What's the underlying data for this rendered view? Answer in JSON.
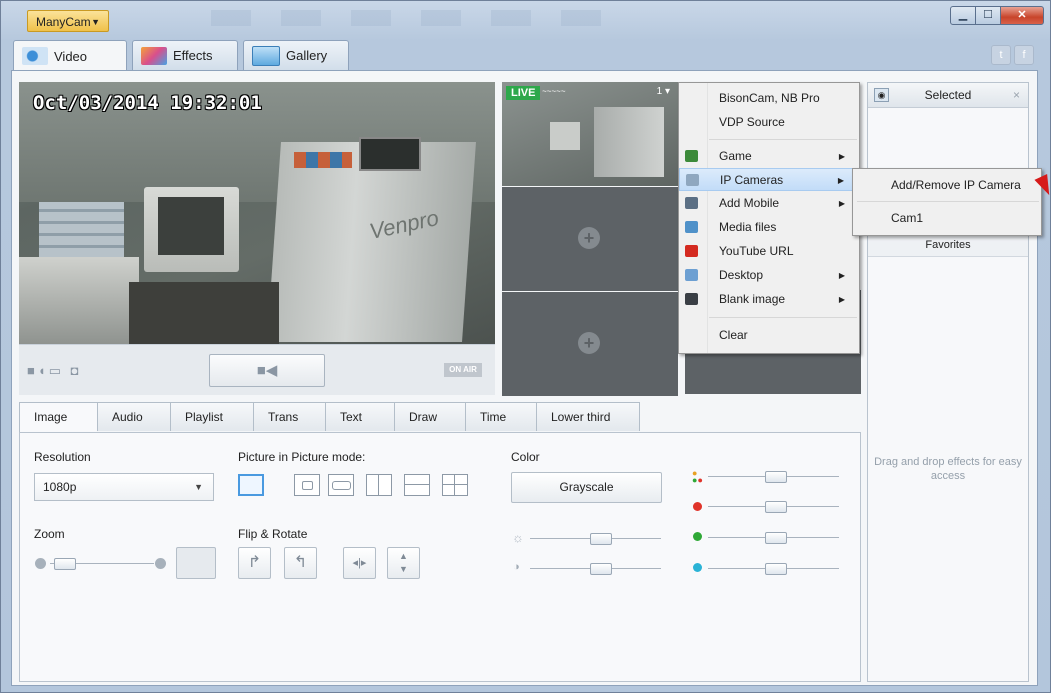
{
  "app": {
    "menu_label": "ManyCam"
  },
  "main_tabs": [
    {
      "label": "Video"
    },
    {
      "label": "Effects"
    },
    {
      "label": "Gallery"
    }
  ],
  "social": {
    "twitter": "t",
    "facebook": "f"
  },
  "video": {
    "timestamp": "Oct/03/2014 19:32:01",
    "brand_text": "Venpro",
    "on_air": "ON AIR"
  },
  "preview": {
    "live_badge": "LIVE",
    "source_num": "1"
  },
  "source_menu": {
    "items": [
      {
        "label": "BisonCam, NB Pro"
      },
      {
        "label": "VDP Source"
      },
      {
        "label": "Game"
      },
      {
        "label": "IP Cameras"
      },
      {
        "label": "Add Mobile"
      },
      {
        "label": "Media files"
      },
      {
        "label": "YouTube URL"
      },
      {
        "label": "Desktop"
      },
      {
        "label": "Blank image"
      },
      {
        "label": "Clear"
      }
    ],
    "submenu": [
      {
        "label": "Add/Remove IP Camera"
      },
      {
        "label": "Cam1"
      }
    ]
  },
  "sidebar": {
    "header": "Selected",
    "close": "×",
    "favorites": "Favorites",
    "hint": "Drag and drop effects for easy access"
  },
  "bottom_tabs": [
    "Image",
    "Audio",
    "Playlist",
    "Trans",
    "Text",
    "Draw",
    "Time",
    "Lower third"
  ],
  "image_panel": {
    "resolution_label": "Resolution",
    "resolution_value": "1080p",
    "pip_label": "Picture in Picture mode:",
    "color_label": "Color",
    "grayscale_button": "Grayscale",
    "zoom_label": "Zoom",
    "flip_label": "Flip & Rotate"
  },
  "colors": {
    "accent": "#4a9ae0",
    "live": "#2ea84b",
    "red": "#e0342a",
    "green": "#2fa836",
    "cyan": "#2ab3d6"
  }
}
